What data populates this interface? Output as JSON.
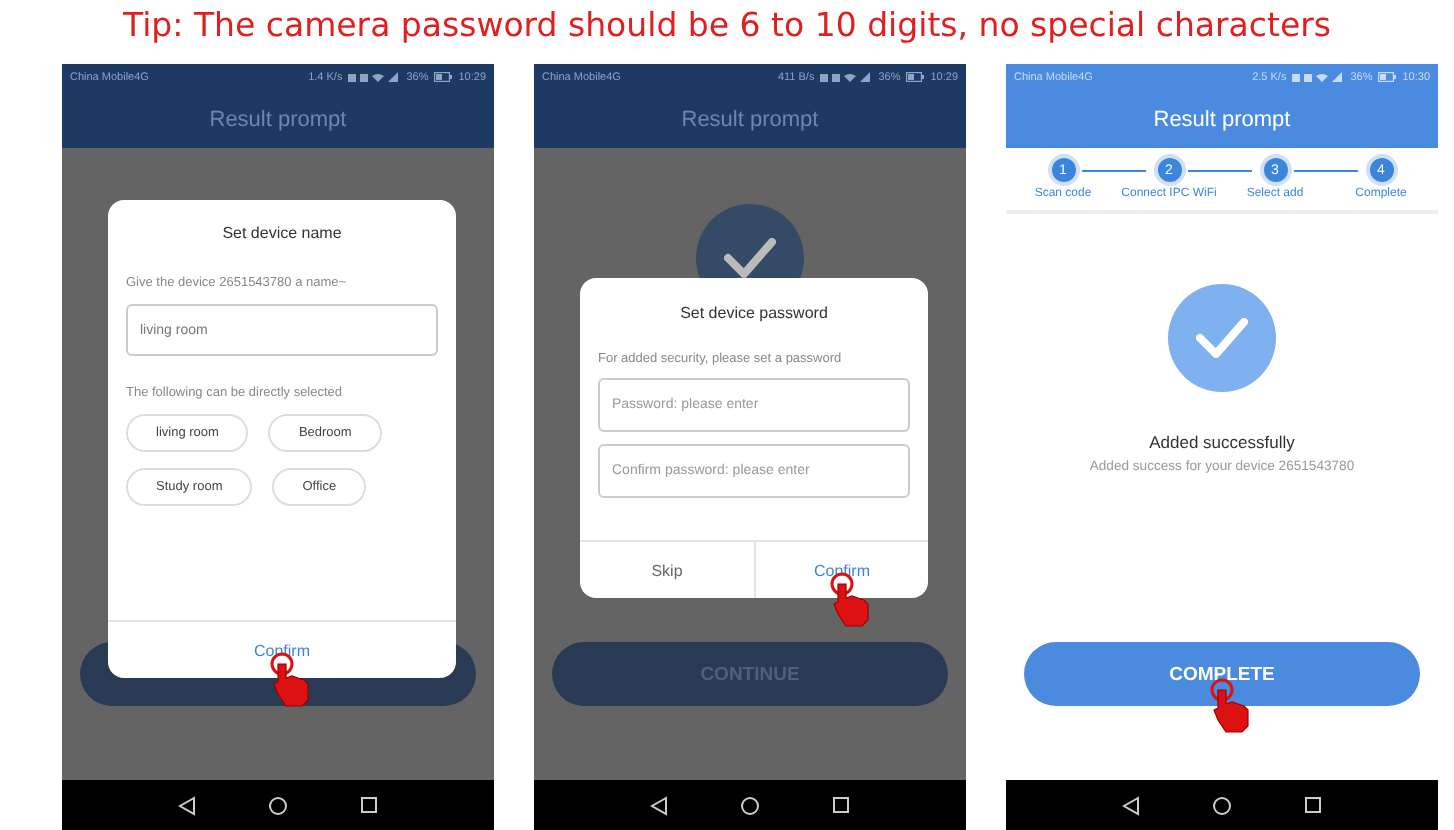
{
  "tip": "Tip: The camera password should be 6 to 10 digits, no special characters",
  "phones": [
    {
      "status_bar": {
        "carrier": "China Mobile4G",
        "speed": "1.4 K/s",
        "battery": "36%",
        "time": "10:29"
      },
      "title": "Result prompt",
      "dimmed": true,
      "continue_button": {
        "tapped": false
      },
      "dialog": {
        "kind": "name",
        "title": "Set device name",
        "prompt": "Give the device 2651543780 a name~",
        "field": {
          "value": "living room"
        },
        "hint": "The following can be directly selected",
        "chips": [
          "living room",
          "Bedroom",
          "Study room",
          "Office"
        ],
        "buttons": [
          {
            "label": "Confirm",
            "tapped": true
          }
        ]
      }
    },
    {
      "status_bar": {
        "carrier": "China Mobile4G",
        "speed": "411 B/s",
        "battery": "36%",
        "time": "10:29"
      },
      "title": "Result prompt",
      "dimmed": true,
      "success_icon": true,
      "continue_button": {
        "label": "CONTINUE",
        "tapped": false
      },
      "dialog": {
        "kind": "password",
        "title": "Set device password",
        "prompt": "For added security, please set a password",
        "fields": [
          {
            "placeholder": "Password: please enter"
          },
          {
            "placeholder": "Confirm password: please enter"
          }
        ],
        "buttons": [
          {
            "label": "Skip",
            "tapped": false
          },
          {
            "label": "Confirm",
            "tapped": true
          }
        ]
      }
    },
    {
      "status_bar": {
        "carrier": "China Mobile4G",
        "speed": "2.5 K/s",
        "battery": "36%",
        "time": "10:30"
      },
      "title": "Result prompt",
      "dimmed": false,
      "success_icon": true,
      "steps": [
        {
          "number": "1",
          "label": "Scan code"
        },
        {
          "number": "2",
          "label": "Connect IPC WiFi"
        },
        {
          "number": "3",
          "label": "Select add"
        },
        {
          "number": "4",
          "label": "Complete"
        }
      ],
      "result": {
        "title": "Added successfully",
        "message": "Added success for your device 2651543780"
      },
      "continue_button": {
        "label": "COMPLETE",
        "tapped": true
      }
    }
  ]
}
